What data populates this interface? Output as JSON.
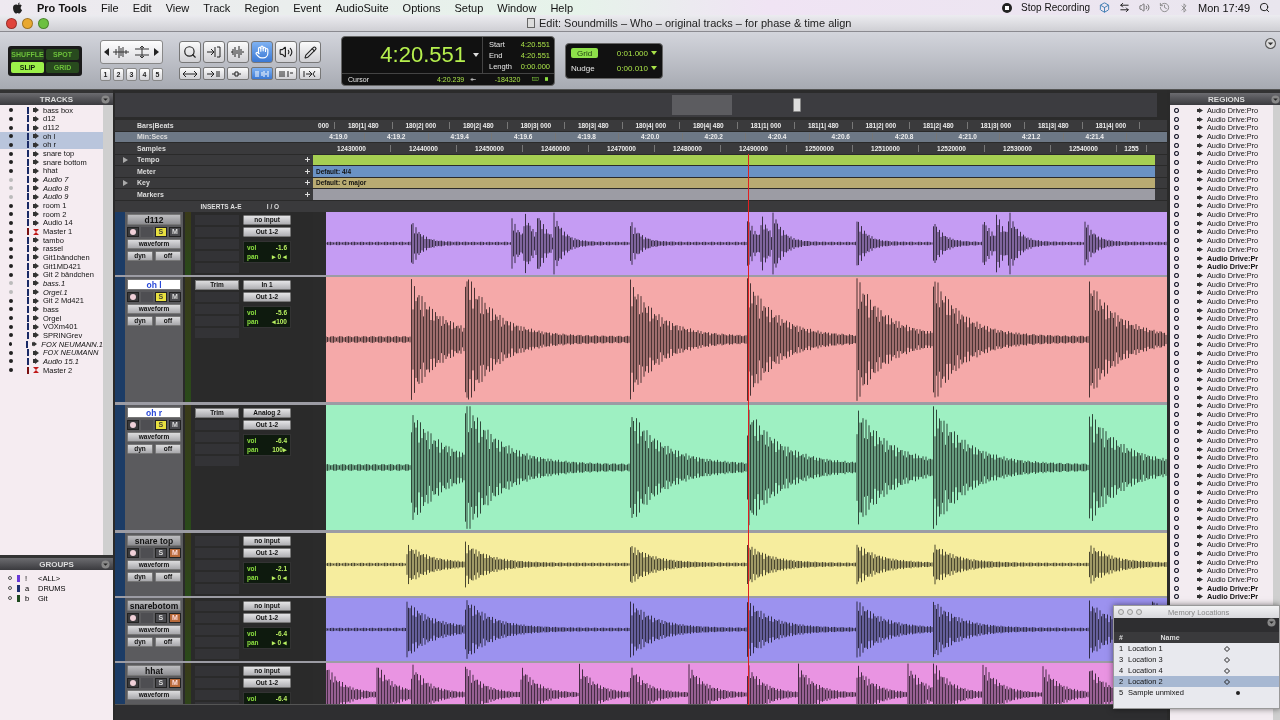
{
  "menu_bar": {
    "app": "Pro Tools",
    "menus": [
      "File",
      "Edit",
      "View",
      "Track",
      "Region",
      "Event",
      "AudioSuite",
      "Options",
      "Setup",
      "Window",
      "Help"
    ],
    "status_item": "Stop Recording",
    "clock": "Mon 17:49"
  },
  "window": {
    "title": "Edit: Soundmills – Who – original tracks – for phase & time align"
  },
  "edit_modes": [
    {
      "label": "SHUFFLE",
      "selected": false
    },
    {
      "label": "SPOT",
      "selected": false
    },
    {
      "label": "SLIP",
      "selected": true
    },
    {
      "label": "GRID",
      "selected": false
    }
  ],
  "zoom_presets": [
    "1",
    "2",
    "3",
    "4",
    "5"
  ],
  "tools": [
    {
      "kind": "zoomer",
      "selected": false
    },
    {
      "kind": "trimmer",
      "selected": false
    },
    {
      "kind": "selector",
      "selected": false
    },
    {
      "kind": "grabber",
      "selected": true
    },
    {
      "kind": "scrubber",
      "selected": false
    },
    {
      "kind": "pencil",
      "selected": false
    }
  ],
  "toggles": [
    {
      "kind": "zoom",
      "on": false
    },
    {
      "kind": "tab",
      "on": false
    },
    {
      "kind": "link",
      "on": false
    },
    {
      "kind": "track-link",
      "on": true
    },
    {
      "kind": "insertion",
      "on": false
    },
    {
      "kind": "mirror",
      "on": false
    }
  ],
  "counter": {
    "main": "4:20.551",
    "start_label": "Start",
    "start": "4:20.551",
    "end_label": "End",
    "end": "4:20.551",
    "length_label": "Length",
    "length": "0:00.000",
    "cursor_label": "Cursor",
    "cursor": "4:20.239",
    "sample_value": "-184320"
  },
  "grid": {
    "label": "Grid",
    "value": "0:01.000",
    "nudge_label": "Nudge",
    "nudge": "0:00.010"
  },
  "tracks_panel": {
    "title": "TRACKS",
    "items": [
      {
        "name": "bass box",
        "kind": "audio",
        "selected": false,
        "inactive": false,
        "shown": true
      },
      {
        "name": "d12",
        "kind": "audio",
        "selected": false,
        "inactive": false,
        "shown": true
      },
      {
        "name": "d112",
        "kind": "audio",
        "selected": false,
        "inactive": false,
        "shown": true
      },
      {
        "name": "oh l",
        "kind": "audio",
        "selected": true,
        "inactive": false,
        "shown": true
      },
      {
        "name": "oh r",
        "kind": "audio",
        "selected": true,
        "inactive": false,
        "shown": true
      },
      {
        "name": "snare top",
        "kind": "audio",
        "selected": false,
        "inactive": false,
        "shown": true
      },
      {
        "name": "snare bottom",
        "kind": "audio",
        "selected": false,
        "inactive": false,
        "shown": true
      },
      {
        "name": "hhat",
        "kind": "audio",
        "selected": false,
        "inactive": false,
        "shown": true
      },
      {
        "name": "Audio 7",
        "kind": "audio",
        "selected": false,
        "inactive": true,
        "shown": false
      },
      {
        "name": "Audio 8",
        "kind": "audio",
        "selected": false,
        "inactive": true,
        "shown": false
      },
      {
        "name": "Audio 9",
        "kind": "audio",
        "selected": false,
        "inactive": true,
        "shown": false
      },
      {
        "name": "room 1",
        "kind": "audio",
        "selected": false,
        "inactive": false,
        "shown": true
      },
      {
        "name": "room 2",
        "kind": "audio",
        "selected": false,
        "inactive": false,
        "shown": true
      },
      {
        "name": "Audio 14",
        "kind": "audio",
        "selected": false,
        "inactive": false,
        "shown": true
      },
      {
        "name": "Master 1",
        "kind": "master",
        "selected": false,
        "inactive": false,
        "shown": true
      },
      {
        "name": "tambo",
        "kind": "audio",
        "selected": false,
        "inactive": false,
        "shown": true
      },
      {
        "name": "rassel",
        "kind": "audio",
        "selected": false,
        "inactive": false,
        "shown": true
      },
      {
        "name": "Git1bändchen",
        "kind": "audio",
        "selected": false,
        "inactive": false,
        "shown": true
      },
      {
        "name": "Git1MD421",
        "kind": "audio",
        "selected": false,
        "inactive": false,
        "shown": true
      },
      {
        "name": "Git 2 bändchen",
        "kind": "audio",
        "selected": false,
        "inactive": false,
        "shown": true
      },
      {
        "name": "bass.1",
        "kind": "audio",
        "selected": false,
        "inactive": true,
        "shown": false
      },
      {
        "name": "Orgel.1",
        "kind": "audio",
        "selected": false,
        "inactive": true,
        "shown": false
      },
      {
        "name": "Git 2 Md421",
        "kind": "audio",
        "selected": false,
        "inactive": false,
        "shown": true
      },
      {
        "name": "bass",
        "kind": "audio",
        "selected": false,
        "inactive": false,
        "shown": true
      },
      {
        "name": "Orgel",
        "kind": "audio",
        "selected": false,
        "inactive": false,
        "shown": true
      },
      {
        "name": "VOXm401",
        "kind": "audio",
        "selected": false,
        "inactive": false,
        "shown": true
      },
      {
        "name": "SPRINGrev",
        "kind": "audio",
        "selected": false,
        "inactive": false,
        "shown": true
      },
      {
        "name": "FOX NEUMANN.1",
        "kind": "audio",
        "selected": false,
        "inactive": true,
        "shown": true
      },
      {
        "name": "FOX NEUMANN",
        "kind": "audio",
        "selected": false,
        "inactive": true,
        "shown": true
      },
      {
        "name": "Audio 15.1",
        "kind": "audio",
        "selected": false,
        "inactive": true,
        "shown": true
      },
      {
        "name": "Master 2",
        "kind": "master",
        "selected": false,
        "inactive": false,
        "shown": true
      }
    ]
  },
  "groups_panel": {
    "title": "GROUPS",
    "items": [
      {
        "letter": "!",
        "name": "<ALL>",
        "color": "#6a3ad8"
      },
      {
        "letter": "a",
        "name": "DRUMS",
        "color": "#1e2f6e"
      },
      {
        "letter": "b",
        "name": "Git",
        "color": "#1f4a1f"
      }
    ]
  },
  "rulers": [
    {
      "label": "Bars|Beats",
      "kind": "time",
      "selected": false,
      "expandable": false,
      "ticks": [
        "000",
        "180|1| 480",
        "180|2| 000",
        "180|2| 480",
        "180|3| 000",
        "180|3| 480",
        "180|4| 000",
        "180|4| 480",
        "181|1| 000",
        "181|1| 480",
        "181|2| 000",
        "181|2| 480",
        "181|3| 000",
        "181|3| 480",
        "181|4| 000"
      ]
    },
    {
      "label": "Min:Secs",
      "kind": "time",
      "selected": true,
      "expandable": false,
      "ticks": [
        "4:19.0",
        "4:19.2",
        "4:19.4",
        "4:19.6",
        "4:19.8",
        "4:20.0",
        "4:20.2",
        "4:20.4",
        "4:20.6",
        "4:20.8",
        "4:21.0",
        "4:21.2",
        "4:21.4"
      ]
    },
    {
      "label": "Samples",
      "kind": "time",
      "selected": false,
      "expandable": false,
      "ticks": [
        "12430000",
        "12440000",
        "12450000",
        "12460000",
        "12470000",
        "12480000",
        "12490000",
        "12500000",
        "12510000",
        "12520000",
        "12530000",
        "12540000",
        "1255"
      ]
    },
    {
      "label": "Tempo",
      "kind": "conductor",
      "selected": false,
      "expandable": true,
      "color": "#a6cf52"
    },
    {
      "label": "Meter",
      "kind": "conductor",
      "selected": false,
      "expandable": false,
      "color": "#6a92c4",
      "value": "Default: 4/4"
    },
    {
      "label": "Key",
      "kind": "conductor",
      "selected": false,
      "expandable": true,
      "color": "#b9ab72",
      "value": "Default: C major"
    },
    {
      "label": "Markers",
      "kind": "conductor",
      "selected": false,
      "expandable": false,
      "color": "#9c9ca4"
    }
  ],
  "column_headers": {
    "inserts": "INSERTS A-E",
    "io": "I / O"
  },
  "tracks": [
    {
      "name": "d112",
      "large": false,
      "solo_label": "S",
      "mute_label": "M",
      "vol_label": "vol",
      "pan_label": "pan",
      "selected": false,
      "solo": true,
      "muted": false,
      "view": "waveform",
      "dyn": "dyn",
      "automation": "off",
      "input": "no input",
      "output": "Out 1-2",
      "vol": "-1.6",
      "pan": "▸ 0 ◂",
      "color": "#c59cf3"
    },
    {
      "name": "oh l",
      "large": true,
      "solo_label": "S",
      "mute_label": "M",
      "vol_label": "vol",
      "pan_label": "pan",
      "selected": true,
      "solo": true,
      "muted": false,
      "view": "waveform",
      "dyn": "dyn",
      "automation": "off",
      "insert": "Trim",
      "input": "In 1",
      "output": "Out 1-2",
      "vol": "-5.6",
      "pan": "◂100",
      "color": "#f5a9a9"
    },
    {
      "name": "oh r",
      "large": true,
      "solo_label": "S",
      "mute_label": "M",
      "vol_label": "vol",
      "pan_label": "pan",
      "selected": true,
      "solo": true,
      "muted": false,
      "view": "waveform",
      "dyn": "dyn",
      "automation": "off",
      "insert": "Trim",
      "input": "Analog 2",
      "output": "Out 1-2",
      "vol": "-6.4",
      "pan": "100▸",
      "color": "#9ef0c2"
    },
    {
      "name": "snare top",
      "large": false,
      "solo_label": "S",
      "mute_label": "M",
      "vol_label": "vol",
      "pan_label": "pan",
      "selected": false,
      "solo": false,
      "muted": true,
      "view": "waveform",
      "dyn": "dyn",
      "automation": "off",
      "input": "no input",
      "output": "Out 1-2",
      "vol": "-2.1",
      "pan": "▸ 0 ◂",
      "color": "#f6ed9e"
    },
    {
      "name": "snarebotom",
      "large": false,
      "solo_label": "S",
      "mute_label": "M",
      "vol_label": "vol",
      "pan_label": "pan",
      "selected": false,
      "solo": false,
      "muted": true,
      "view": "waveform",
      "dyn": "dyn",
      "automation": "off",
      "input": "no input",
      "output": "Out 1-2",
      "vol": "-6.4",
      "pan": "▸ 0 ◂",
      "color": "#9c92ef"
    },
    {
      "name": "hhat",
      "large": false,
      "solo_label": "S",
      "mute_label": "M",
      "vol_label": "vol",
      "selected": false,
      "solo": false,
      "muted": true,
      "view": "waveform",
      "input": "no input",
      "output": "Out 1-2",
      "vol": "-6.4",
      "color": "#e994e2"
    }
  ],
  "regions_panel": {
    "title": "REGIONS",
    "items": [
      {
        "name": "Audio Drive:Pro",
        "whole_file": false
      },
      {
        "name": "Audio Drive:Pro",
        "whole_file": false
      },
      {
        "name": "Audio Drive:Pro",
        "whole_file": false
      },
      {
        "name": "Audio Drive:Pro",
        "whole_file": false
      },
      {
        "name": "Audio Drive:Pro",
        "whole_file": false
      },
      {
        "name": "Audio Drive:Pro",
        "whole_file": false
      },
      {
        "name": "Audio Drive:Pro",
        "whole_file": false
      },
      {
        "name": "Audio Drive:Pro",
        "whole_file": false
      },
      {
        "name": "Audio Drive:Pro",
        "whole_file": false
      },
      {
        "name": "Audio Drive:Pro",
        "whole_file": false
      },
      {
        "name": "Audio Drive:Pro",
        "whole_file": false
      },
      {
        "name": "Audio Drive:Pro",
        "whole_file": false
      },
      {
        "name": "Audio Drive:Pro",
        "whole_file": false
      },
      {
        "name": "Audio Drive:Pro",
        "whole_file": false
      },
      {
        "name": "Audio Drive:Pro",
        "whole_file": false
      },
      {
        "name": "Audio Drive:Pro",
        "whole_file": false
      },
      {
        "name": "Audio Drive:Pro",
        "whole_file": false
      },
      {
        "name": "Audio Drive:Pr",
        "whole_file": true
      },
      {
        "name": "Audio Drive:Pr",
        "whole_file": true
      },
      {
        "name": "Audio Drive:Pro",
        "whole_file": false
      },
      {
        "name": "Audio Drive:Pro",
        "whole_file": false
      },
      {
        "name": "Audio Drive:Pro",
        "whole_file": false
      },
      {
        "name": "Audio Drive:Pro",
        "whole_file": false
      },
      {
        "name": "Audio Drive:Pro",
        "whole_file": false
      },
      {
        "name": "Audio Drive:Pro",
        "whole_file": false
      },
      {
        "name": "Audio Drive:Pro",
        "whole_file": false
      },
      {
        "name": "Audio Drive:Pro",
        "whole_file": false
      },
      {
        "name": "Audio Drive:Pro",
        "whole_file": false
      },
      {
        "name": "Audio Drive:Pro",
        "whole_file": false
      },
      {
        "name": "Audio Drive:Pro",
        "whole_file": false
      },
      {
        "name": "Audio Drive:Pro",
        "whole_file": false
      },
      {
        "name": "Audio Drive:Pro",
        "whole_file": false
      },
      {
        "name": "Audio Drive:Pro",
        "whole_file": false
      },
      {
        "name": "Audio Drive:Pro",
        "whole_file": false
      },
      {
        "name": "Audio Drive:Pro",
        "whole_file": false
      },
      {
        "name": "Audio Drive:Pro",
        "whole_file": false
      },
      {
        "name": "Audio Drive:Pro",
        "whole_file": false
      },
      {
        "name": "Audio Drive:Pro",
        "whole_file": false
      },
      {
        "name": "Audio Drive:Pro",
        "whole_file": false
      },
      {
        "name": "Audio Drive:Pro",
        "whole_file": false
      },
      {
        "name": "Audio Drive:Pro",
        "whole_file": false
      },
      {
        "name": "Audio Drive:Pro",
        "whole_file": false
      },
      {
        "name": "Audio Drive:Pro",
        "whole_file": false
      },
      {
        "name": "Audio Drive:Pro",
        "whole_file": false
      },
      {
        "name": "Audio Drive:Pro",
        "whole_file": false
      },
      {
        "name": "Audio Drive:Pro",
        "whole_file": false
      },
      {
        "name": "Audio Drive:Pro",
        "whole_file": false
      },
      {
        "name": "Audio Drive:Pro",
        "whole_file": false
      },
      {
        "name": "Audio Drive:Pro",
        "whole_file": false
      },
      {
        "name": "Audio Drive:Pro",
        "whole_file": false
      },
      {
        "name": "Audio Drive:Pro",
        "whole_file": false
      },
      {
        "name": "Audio Drive:Pro",
        "whole_file": false
      },
      {
        "name": "Audio Drive:Pro",
        "whole_file": false
      },
      {
        "name": "Audio Drive:Pro",
        "whole_file": false
      },
      {
        "name": "Audio Drive:Pro",
        "whole_file": false
      },
      {
        "name": "Audio Drive:Pr",
        "whole_file": true
      },
      {
        "name": "Audio Drive:Pr",
        "whole_file": true
      }
    ]
  },
  "memory_locations": {
    "title": "Memory Locations",
    "columns": [
      "#",
      "Name"
    ],
    "rows": [
      {
        "number": "1",
        "name": "Location 1",
        "kind": "marker",
        "selected": false
      },
      {
        "number": "3",
        "name": "Location 3",
        "kind": "marker",
        "selected": false
      },
      {
        "number": "4",
        "name": "Location 4",
        "kind": "marker",
        "selected": false
      },
      {
        "number": "2",
        "name": "Location 2",
        "kind": "marker",
        "selected": true
      },
      {
        "number": "5",
        "name": "Sample unmixed",
        "kind": "selection",
        "selected": false
      }
    ]
  }
}
